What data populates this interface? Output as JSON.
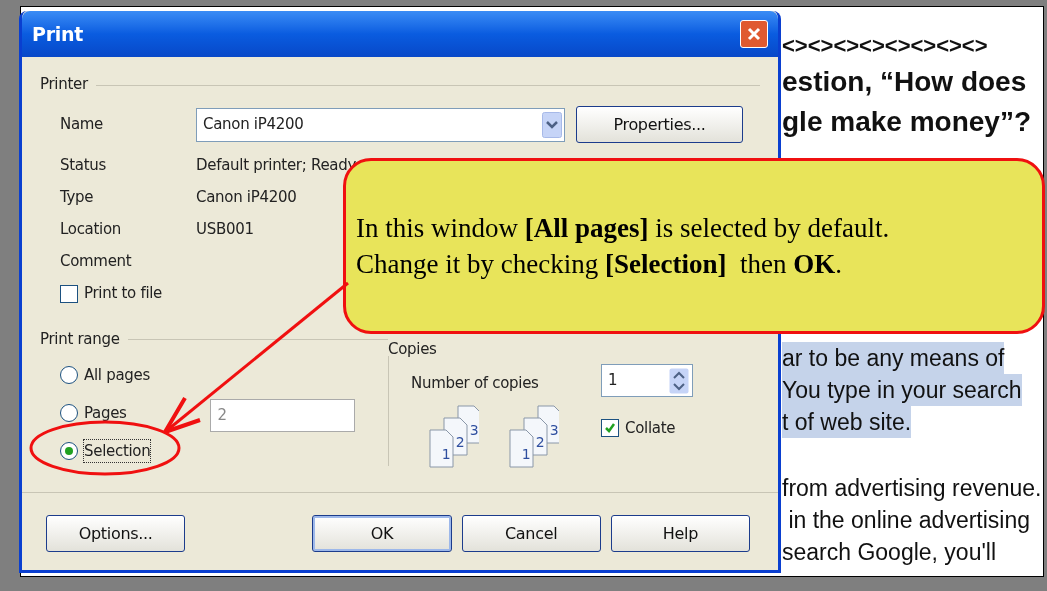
{
  "window": {
    "title": "Print"
  },
  "printer": {
    "group_label": "Printer",
    "name_label": "Name",
    "name_value": "Canon iP4200",
    "properties_button": {
      "label": "Properties..."
    },
    "fields": [
      {
        "label": "Status",
        "value": "Default printer; Ready"
      },
      {
        "label": "Type",
        "value": "Canon iP4200"
      },
      {
        "label": "Location",
        "value": "USB001"
      },
      {
        "label": "Comment"
      }
    ],
    "print_to_file": {
      "label": "Print to file",
      "checked": false
    }
  },
  "print_range": {
    "label": "Print range",
    "options": [
      {
        "label": "All pages",
        "selected": false
      },
      {
        "label": "Pages",
        "selected": false
      },
      {
        "label": "Selection",
        "selected": true
      }
    ],
    "pages_value": "2"
  },
  "copies": {
    "label": "Copies",
    "number_label": "Number of copies",
    "number_value": "1",
    "page_stacks": [
      {
        "pages": [
          "1",
          "2",
          "3"
        ]
      },
      {
        "pages": [
          "1",
          "2",
          "3"
        ]
      }
    ],
    "collate": {
      "label": "Collate",
      "checked": true
    }
  },
  "buttons": [
    {
      "label": "Options...",
      "default": false
    },
    {
      "label": "OK",
      "default": true
    },
    {
      "label": "Cancel",
      "default": false
    },
    {
      "label": "Help",
      "default": false
    }
  ],
  "callout": {
    "lines": [
      "In this window **[All pages]** is selected by default.",
      "Change it by checking **[Selection]**  then **OK**."
    ]
  },
  "document": {
    "heading": "<><><><><><><><>",
    "title_lines": [
      "estion, “How does",
      "gle make money”?"
    ],
    "lines": [
      {
        "text": "ar to be any means of",
        "highlighted": true
      },
      {
        "text": "You type in your search",
        "highlighted": true
      },
      {
        "text": "t of web site.",
        "highlighted": true
      },
      {
        "text": "from advertising revenue.",
        "highlighted": false
      },
      {
        "text": " in the online advertising",
        "highlighted": false
      },
      {
        "text": "search Google, you'll",
        "highlighted": false
      }
    ]
  }
}
